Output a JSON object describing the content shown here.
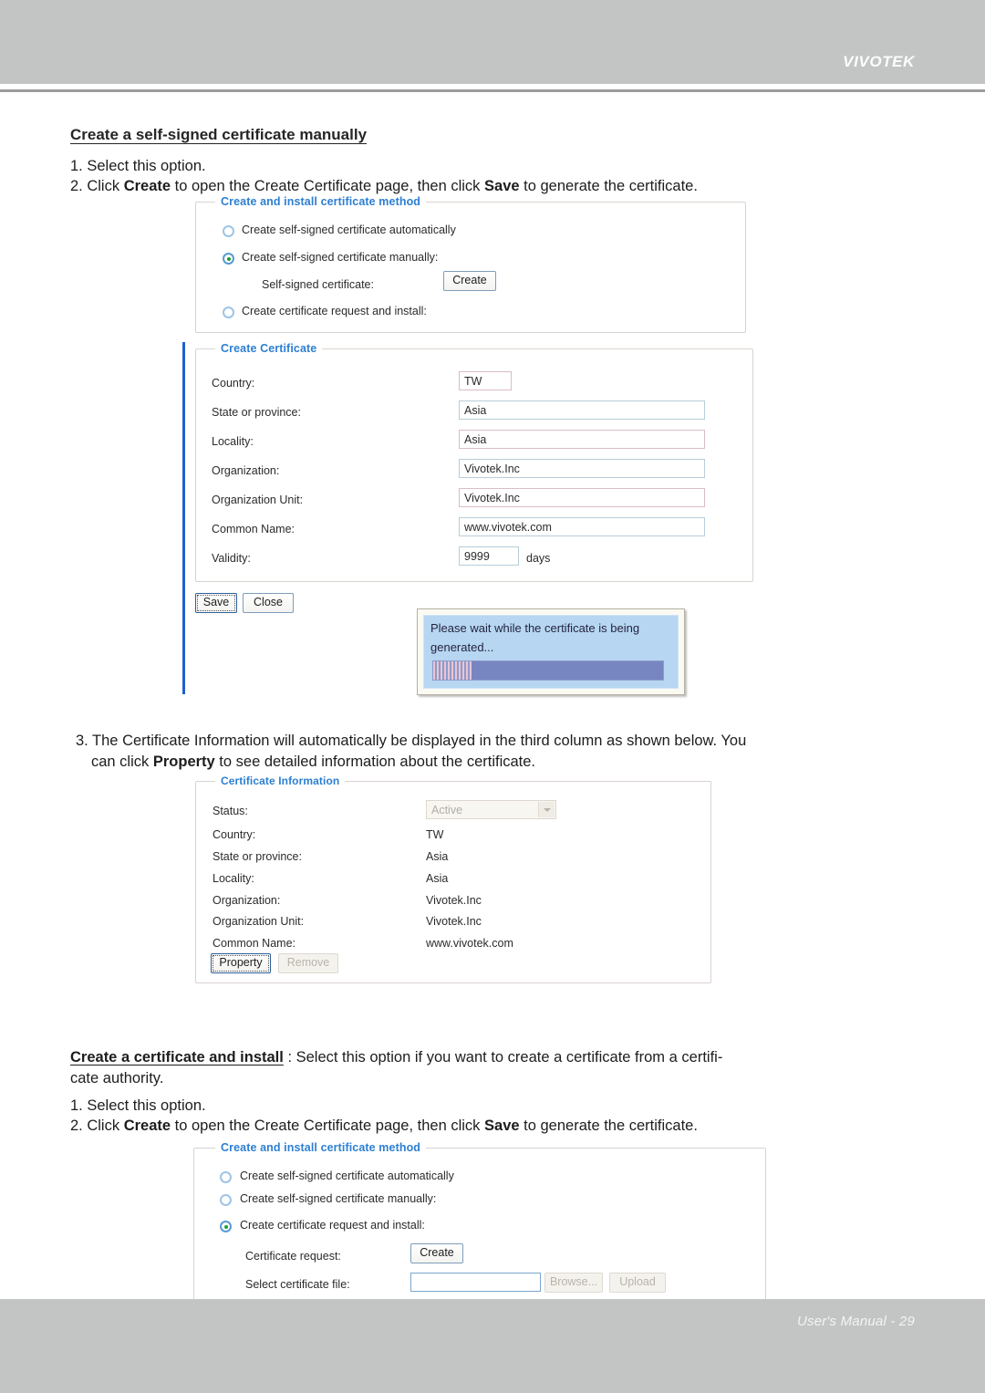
{
  "page": {
    "brand": "VIVOTEK",
    "footer": "User's Manual - 29"
  },
  "section1": {
    "heading": "Create a self-signed certificate manually",
    "step1": "1. Select this option.",
    "step2_pre": "2. Click ",
    "step2_b1": "Create",
    "step2_mid": " to open the Create Certificate page, then click ",
    "step2_b2": "Save",
    "step2_post": " to generate the certificate."
  },
  "method_panel_1": {
    "legend": "Create and install certificate method",
    "options": [
      {
        "label": "Create self-signed certificate automatically",
        "checked": false
      },
      {
        "label": "Create self-signed certificate manually:",
        "checked": true
      },
      {
        "label": "Create certificate request and install:",
        "checked": false
      }
    ],
    "sub_label": "Self-signed certificate:",
    "create_button": "Create"
  },
  "create_certificate": {
    "legend": "Create Certificate",
    "fields": [
      {
        "label": "Country:",
        "value": "TW"
      },
      {
        "label": "State or province:",
        "value": "Asia"
      },
      {
        "label": "Locality:",
        "value": "Asia"
      },
      {
        "label": "Organization:",
        "value": "Vivotek.Inc"
      },
      {
        "label": "Organization Unit:",
        "value": "Vivotek.Inc"
      },
      {
        "label": "Common Name:",
        "value": "www.vivotek.com"
      },
      {
        "label": "Validity:",
        "value": "9999"
      }
    ],
    "validity_unit": "days",
    "save_button": "Save",
    "close_button": "Close"
  },
  "wait_dialog": {
    "message": "Please wait while the certificate is being generated...",
    "progress_percent": 16
  },
  "section3": {
    "line1_pre": "3. The Certificate Information will automatically be displayed in the third column as shown below. You",
    "line2_pre": "can click ",
    "line2_b": "Property",
    "line2_post": " to see detailed information about the certificate."
  },
  "certificate_information": {
    "legend": "Certificate Information",
    "status_label": "Status:",
    "status_value": "Active",
    "rows": [
      {
        "label": "Country:",
        "value": "TW"
      },
      {
        "label": "State or province:",
        "value": "Asia"
      },
      {
        "label": "Locality:",
        "value": "Asia"
      },
      {
        "label": "Organization:",
        "value": "Vivotek.Inc"
      },
      {
        "label": "Organization Unit:",
        "value": "Vivotek.Inc"
      },
      {
        "label": "Common Name:",
        "value": "www.vivotek.com"
      }
    ],
    "property_button": "Property",
    "remove_button": "Remove"
  },
  "section2": {
    "heading": "Create a certificate and install",
    "desc_line1": " : Select this option if you want to create a certificate from a certifi-",
    "desc_line2": "cate authority.",
    "step1": "1. Select this option.",
    "step2_pre": "2. Click ",
    "step2_b1": "Create",
    "step2_mid": " to open the Create Certificate page, then click ",
    "step2_b2": "Save",
    "step2_post": " to generate the certificate."
  },
  "method_panel_2": {
    "legend": "Create and install certificate method",
    "options": [
      {
        "label": "Create self-signed certificate automatically",
        "checked": false
      },
      {
        "label": "Create self-signed certificate manually:",
        "checked": false
      },
      {
        "label": "Create certificate request and install:",
        "checked": true
      }
    ],
    "request_label": "Certificate request:",
    "create_button": "Create",
    "file_label": "Select certificate file:",
    "file_value": "",
    "browse_button": "Browse...",
    "upload_button": "Upload"
  }
}
